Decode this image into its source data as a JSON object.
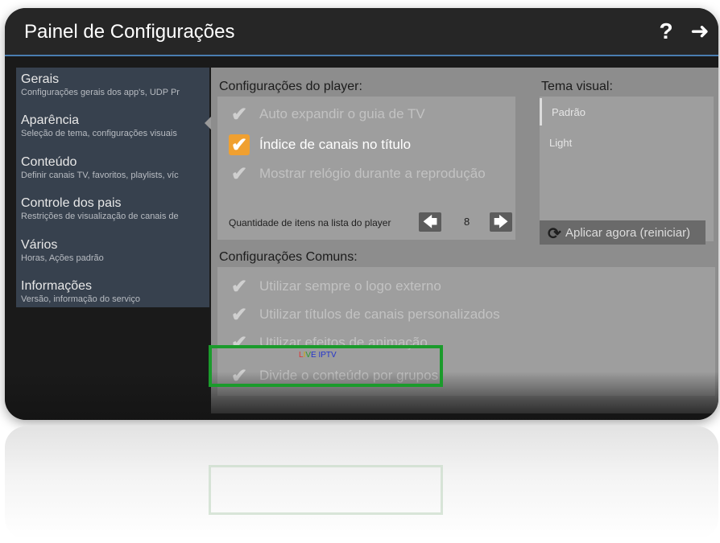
{
  "title": "Painel de Configurações",
  "header_buttons": {
    "help": "?",
    "forward": "➜"
  },
  "sidebar": {
    "items": [
      {
        "label": "Gerais",
        "sub": "Configurações gerais dos app's, UDP Pr"
      },
      {
        "label": "Aparência",
        "sub": "Seleção de tema, configurações visuais"
      },
      {
        "label": "Conteúdo",
        "sub": "Definir canais TV, favoritos, playlists, víc"
      },
      {
        "label": "Controle dos pais",
        "sub": "Restrições de visualização de canais de"
      },
      {
        "label": "Vários",
        "sub": "Horas, Ações padrão"
      },
      {
        "label": "Informações",
        "sub": "Versão, informação do serviço"
      }
    ]
  },
  "player": {
    "title": "Configurações do player:",
    "options": [
      {
        "label": "Auto expandir o guia de TV",
        "checked": false
      },
      {
        "label": "Índice de canais no título",
        "checked": true
      },
      {
        "label": "Mostrar relógio durante a reprodução",
        "checked": false
      }
    ],
    "qty_label": "Quantidade de itens na lista do player",
    "qty_value": "8"
  },
  "theme": {
    "title": "Tema visual:",
    "options": [
      "Padrão",
      "Light"
    ],
    "apply_label": "Aplicar agora (reiniciar)"
  },
  "common": {
    "title": "Configurações Comuns:",
    "options": [
      {
        "label": "Utilizar sempre o logo externo",
        "checked": false
      },
      {
        "label": "Utilizar títulos de canais personalizados",
        "checked": false
      },
      {
        "label": "Utilizar efeitos de animação",
        "checked": false
      },
      {
        "label": "Divide o conteúdo por grupos",
        "checked": false
      }
    ]
  },
  "watermark": {
    "l": "L",
    "i": "I",
    "v": "V",
    "rest": "E IPTV"
  },
  "icons": {
    "check": "check-icon",
    "left": "arrow-left-icon",
    "right": "arrow-right-icon",
    "refresh": "refresh-icon"
  },
  "colors": {
    "accent": "#f0a030",
    "highlight": "#1b9b2c",
    "title_rule": "#4a7db0"
  }
}
